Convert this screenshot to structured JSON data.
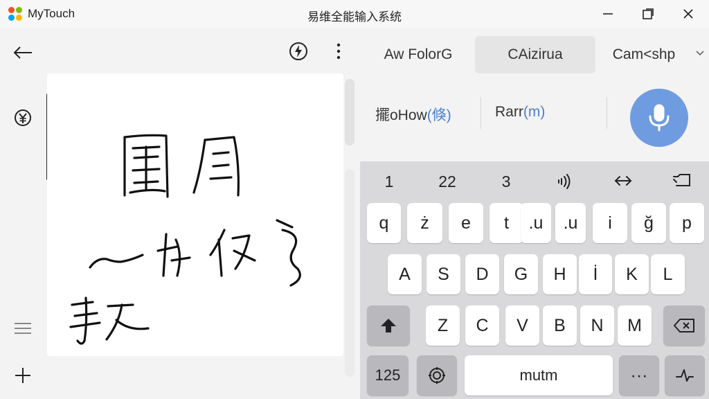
{
  "titlebar": {
    "app_name": "MyTouch",
    "title": "易维全能输入系统",
    "logo_colors": [
      "#f25022",
      "#7fba00",
      "#00a4ef",
      "#ffb900"
    ]
  },
  "left_toolbar": {
    "back": "back-arrow-icon",
    "rail_icon": "currency-icon",
    "menu": "hamburger-icon",
    "add": "plus-icon",
    "flash": "flash-icon",
    "more": "more-vertical-icon"
  },
  "tabs": [
    {
      "label": "Aw FolorG",
      "active": false
    },
    {
      "label": "CAizirua",
      "active": true
    },
    {
      "label": "Cam<shp",
      "active": false
    }
  ],
  "candidates": [
    {
      "main": "擺oHow",
      "sub": "(倏)"
    },
    {
      "main": "Rarr",
      "sub": "(m)"
    }
  ],
  "keyboard": {
    "number_row": [
      "1",
      "22",
      "3"
    ],
    "number_row_icons": [
      "sound-wave-icon",
      "left-right-arrow-icon",
      "screen-icon"
    ],
    "row1": [
      "q",
      "ż",
      "e",
      "t",
      ".u",
      ".u",
      "i",
      "ğ",
      "p"
    ],
    "row2": [
      "A",
      "S",
      "D",
      "G",
      "H",
      "İ",
      "K",
      "L"
    ],
    "row3": [
      "Z",
      "C",
      "V",
      "B",
      "N",
      "M"
    ],
    "bottom": {
      "numbers": "125",
      "space": "mutm",
      "more": "···"
    }
  },
  "colors": {
    "accent": "#6f9ce0",
    "candidate_highlight": "#4a7fd4",
    "keyboard_bg": "#d9d9db"
  }
}
